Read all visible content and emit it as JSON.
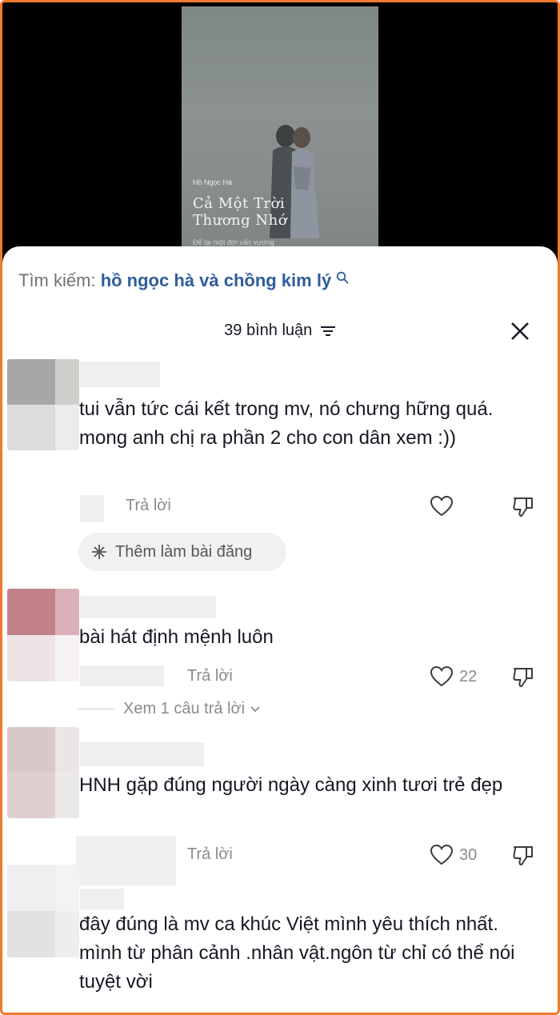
{
  "video": {
    "artist": "Hồ Ngọc Hà",
    "song_line1": "Cả Một Trời",
    "song_line2": "Thương Nhớ",
    "subtitle": "Để lại một đời vấn vương"
  },
  "search": {
    "label": "Tìm kiếm:",
    "query": "hồ ngọc hà và chồng kim lý"
  },
  "header": {
    "title": "39 bình luận"
  },
  "comments": [
    {
      "text": "tui vẫn tức cái kết trong mv, nó chưng hững quá. mong anh chị ra phần 2 cho con dân xem :))",
      "reply_label": "Trả lời",
      "likes": ""
    },
    {
      "text": "bài hát định mệnh luôn",
      "reply_label": "Trả lời",
      "likes": "22"
    },
    {
      "text": "HNH gặp đúng người ngày càng xinh tươi trẻ đẹp",
      "reply_label": "Trả lời",
      "likes": "30"
    },
    {
      "text": "đây đúng là mv ca khúc Việt mình yêu thích nhất. mình từ phân cảnh .nhân vật.ngôn từ chỉ có thể nói tuyệt vời"
    }
  ],
  "add_post_chip": {
    "label": "Thêm làm bài đăng"
  },
  "view_replies": {
    "label": "Xem 1 câu trả lời"
  },
  "colors": {
    "frame": "#f07a2e",
    "query": "#2f5c9c",
    "muted": "#8a8b91"
  }
}
